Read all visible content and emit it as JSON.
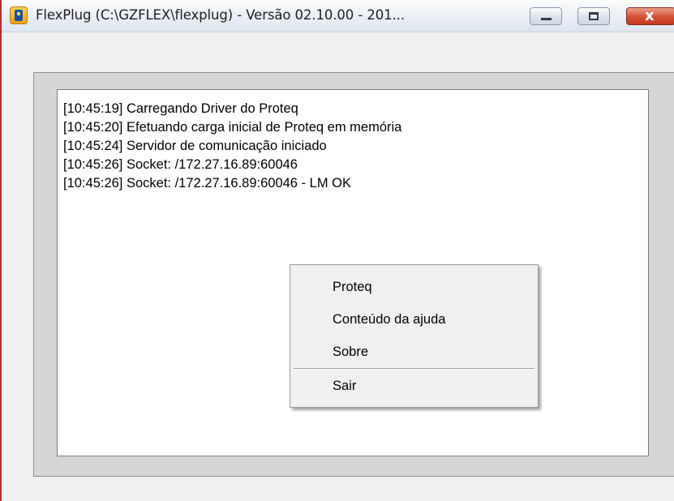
{
  "window": {
    "title": "FlexPlug (C:\\GZFLEX\\flexplug) - Versão 02.10.00 - 201...",
    "app_icon": "flexplug-app-icon",
    "controls": {
      "minimize_icon": "minimize-icon",
      "maximize_icon": "maximize-icon",
      "close_icon": "close-icon",
      "close_glyph": "x",
      "close_color": "#c9452b"
    }
  },
  "log": {
    "lines": [
      "[10:45:19] Carregando Driver do Proteq",
      "[10:45:20] Efetuando carga inicial de Proteq em memória",
      "[10:45:24] Servidor de comunicação iniciado",
      "[10:45:26] Socket: /172.27.16.89:60046",
      "[10:45:26] Socket: /172.27.16.89:60046 - LM OK"
    ]
  },
  "context_menu": {
    "items": [
      {
        "label": "Proteq"
      },
      {
        "label": "Conteúdo da ajuda"
      },
      {
        "label": "Sobre"
      },
      {
        "label": "Sair"
      }
    ]
  }
}
